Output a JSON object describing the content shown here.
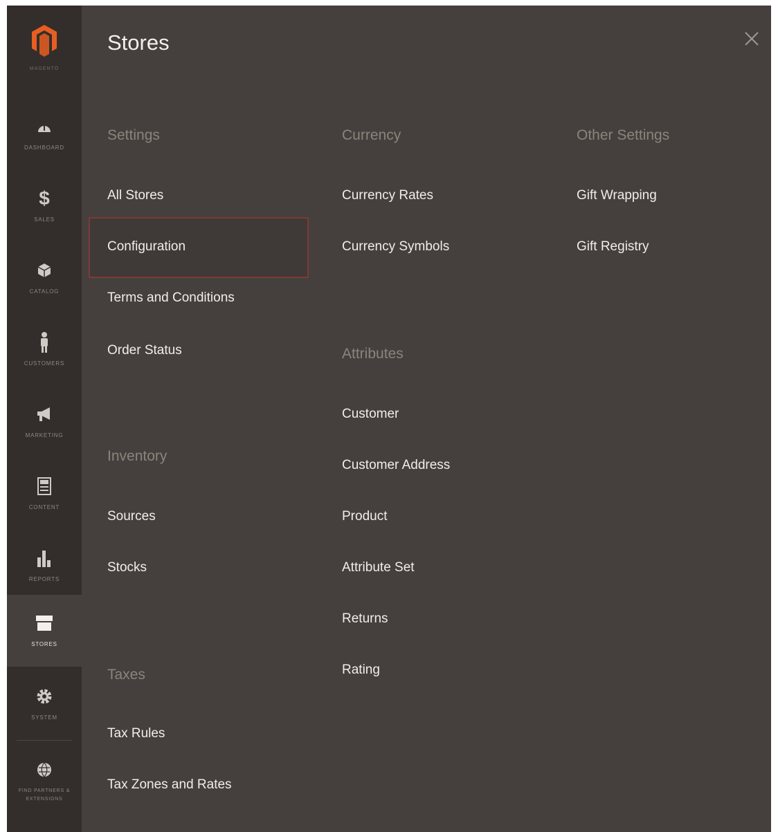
{
  "sidebar": {
    "logo_caption": "MAGENTO",
    "items": [
      {
        "label": "Dashboard",
        "icon": "dashboard-icon"
      },
      {
        "label": "Sales",
        "icon": "dollar-icon"
      },
      {
        "label": "Catalog",
        "icon": "cube-icon"
      },
      {
        "label": "Customers",
        "icon": "person-icon"
      },
      {
        "label": "Marketing",
        "icon": "megaphone-icon"
      },
      {
        "label": "Content",
        "icon": "layout-icon"
      },
      {
        "label": "Reports",
        "icon": "bar-chart-icon"
      },
      {
        "label": "Stores",
        "icon": "store-icon"
      },
      {
        "label": "System",
        "icon": "gear-icon"
      },
      {
        "label": "Find Partners & Extensions",
        "icon": "puzzle-globe-icon"
      }
    ]
  },
  "panel": {
    "title": "Stores",
    "sections": {
      "settings": {
        "heading": "Settings",
        "links": [
          "All Stores",
          "Configuration",
          "Terms and Conditions",
          "Order Status"
        ]
      },
      "inventory": {
        "heading": "Inventory",
        "links": [
          "Sources",
          "Stocks"
        ]
      },
      "taxes": {
        "heading": "Taxes",
        "links": [
          "Tax Rules",
          "Tax Zones and Rates"
        ]
      },
      "currency": {
        "heading": "Currency",
        "links": [
          "Currency Rates",
          "Currency Symbols"
        ]
      },
      "attributes": {
        "heading": "Attributes",
        "links": [
          "Customer",
          "Customer Address",
          "Product",
          "Attribute Set",
          "Returns",
          "Rating"
        ]
      },
      "other_settings": {
        "heading": "Other Settings",
        "links": [
          "Gift Wrapping",
          "Gift Registry"
        ]
      }
    }
  },
  "colors": {
    "panel_bg": "#45403d",
    "sidebar_bg": "#332e2b",
    "highlight_border": "#7d3b37",
    "brand_orange": "#e85d22"
  }
}
